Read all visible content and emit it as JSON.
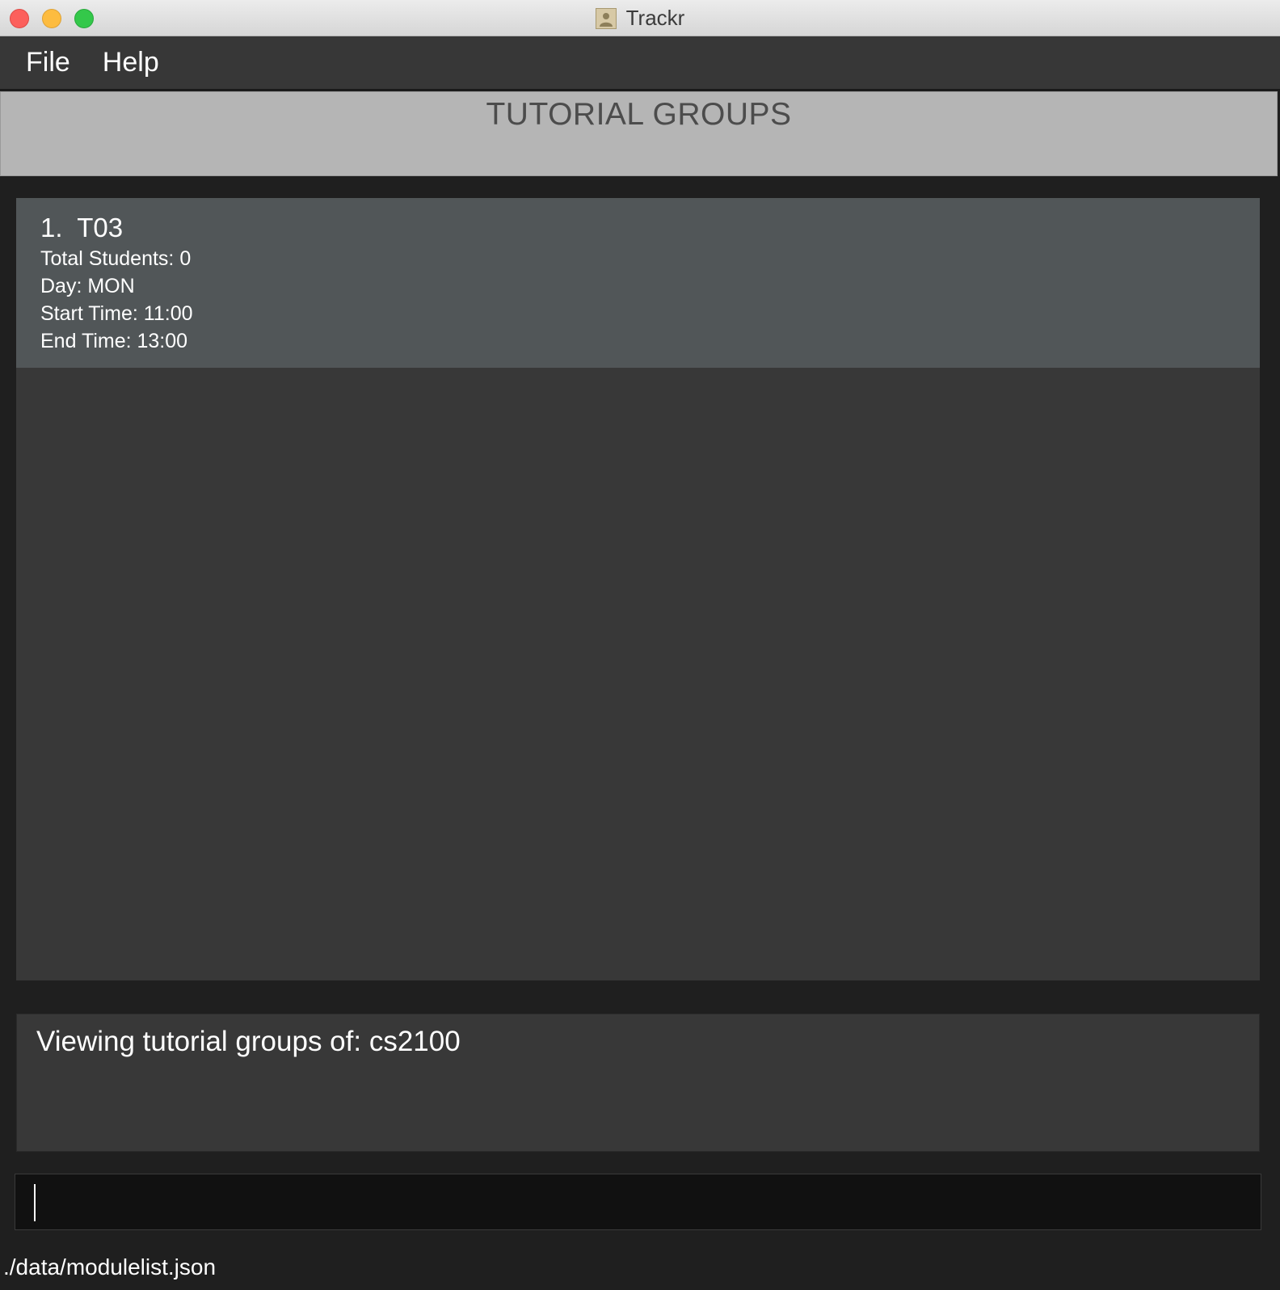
{
  "window": {
    "title": "Trackr",
    "app_icon": "address-book-icon"
  },
  "menu": {
    "items": [
      {
        "label": "File"
      },
      {
        "label": "Help"
      }
    ]
  },
  "header": {
    "title": "TUTORIAL GROUPS"
  },
  "list": {
    "items": [
      {
        "title": "1.  T03",
        "total_students": "Total Students: 0",
        "day": "Day: MON",
        "start_time": "Start Time: 11:00",
        "end_time": "End Time: 13:00"
      }
    ]
  },
  "result": {
    "message": "Viewing tutorial groups of: cs2100"
  },
  "command": {
    "value": "",
    "placeholder": ""
  },
  "status": {
    "file_path": "./data/modulelist.json"
  },
  "colors": {
    "menu_bg": "#373737",
    "header_bg": "#b5b5b5",
    "card_bg": "#515658",
    "panel_bg": "#383838",
    "window_bg": "#1f1f1f",
    "command_bg": "#111111"
  }
}
